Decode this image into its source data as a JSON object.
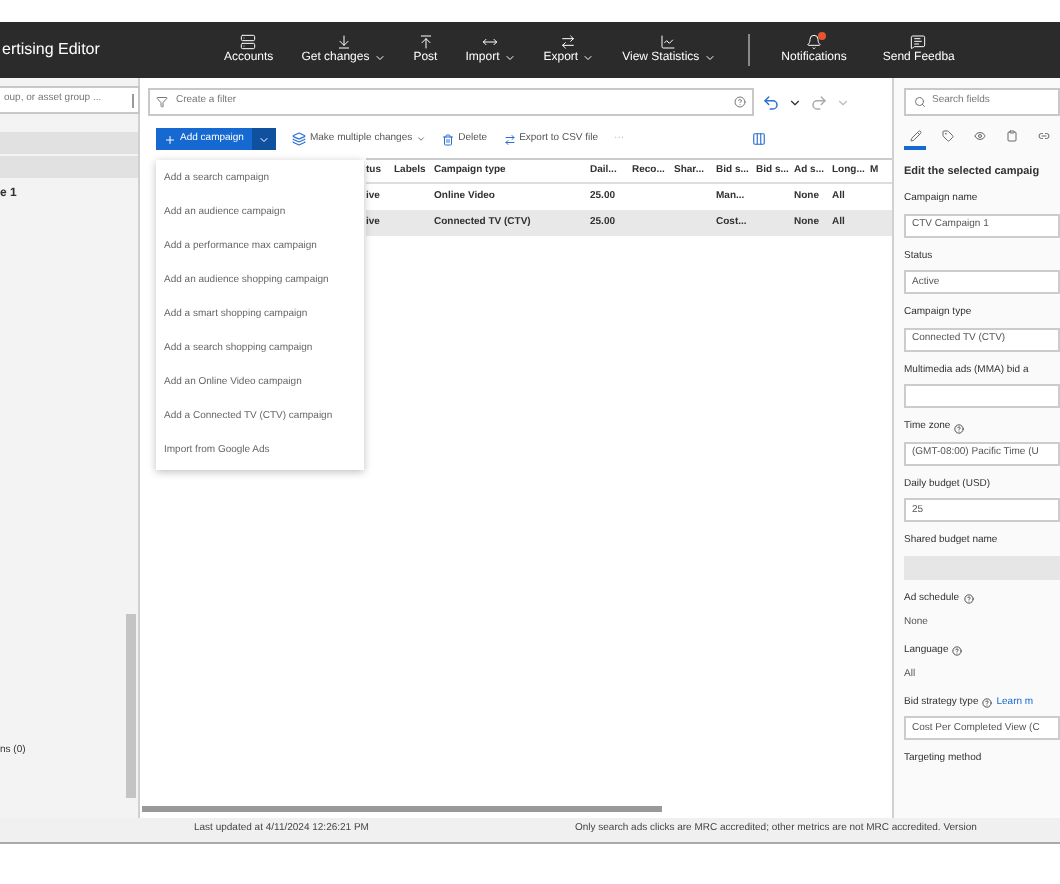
{
  "app_title": "ertising Editor",
  "toolbar": [
    {
      "label": "Accounts",
      "dropdown": false
    },
    {
      "label": "Get changes",
      "dropdown": true
    },
    {
      "label": "Post",
      "dropdown": false
    },
    {
      "label": "Import",
      "dropdown": true
    },
    {
      "label": "Export",
      "dropdown": true
    },
    {
      "label": "View Statistics",
      "dropdown": true
    }
  ],
  "toolbar_right": [
    {
      "label": "Notifications",
      "alert": true
    },
    {
      "label": "Send Feedba",
      "alert": false
    }
  ],
  "sidebar": {
    "search_placeholder": "oup, or asset group ...",
    "items": [
      {
        "label": "e 1"
      }
    ],
    "footer_item": "ns (0)"
  },
  "filter": {
    "placeholder": "Create a filter"
  },
  "actions": {
    "add": "Add campaign",
    "multiple": "Make multiple changes",
    "delete": "Delete",
    "export": "Export to CSV file",
    "more": "···"
  },
  "dropdown_menu": [
    "Add a search campaign",
    "Add an audience campaign",
    "Add a performance max campaign",
    "Add an audience shopping campaign",
    "Add a smart shopping campaign",
    "Add a search shopping campaign",
    "Add an Online Video campaign",
    "Add a Connected TV (CTV) campaign",
    "Import from Google Ads"
  ],
  "table": {
    "columns": [
      "tus",
      "Labels",
      "Campaign type",
      "Dail...",
      "Reco...",
      "Shar...",
      "Bid s...",
      "Bid s...",
      "Ad s...",
      "Long...",
      "M"
    ],
    "rows": [
      {
        "selected": false,
        "cells": [
          "ive",
          null,
          "Online Video",
          "25.00",
          null,
          null,
          "Man...",
          null,
          "None",
          "All",
          null
        ]
      },
      {
        "selected": true,
        "cells": [
          "ive",
          null,
          "Connected TV (CTV)",
          "25.00",
          null,
          null,
          "Cost...",
          null,
          "None",
          "All",
          null
        ]
      }
    ]
  },
  "editor": {
    "search_placeholder": "Search fields",
    "tabs": [
      {
        "selected": true
      },
      {
        "selected": false
      },
      {
        "selected": false
      },
      {
        "selected": false
      },
      {
        "selected": false
      }
    ],
    "heading": "Edit the selected campaig",
    "fields": [
      {
        "label": "Campaign name",
        "kind": "input",
        "value": "CTV Campaign 1",
        "help": false
      },
      {
        "label": "Status",
        "kind": "input",
        "value": "Active",
        "help": false
      },
      {
        "label": "Campaign type",
        "kind": "input",
        "value": "Connected TV (CTV)",
        "help": false
      },
      {
        "label": "Multimedia ads (MMA) bid a",
        "kind": "input",
        "help": false
      },
      {
        "label": "Time zone",
        "kind": "input",
        "value": "(GMT-08:00) Pacific Time (U",
        "help": true
      },
      {
        "label": "Daily budget (USD)",
        "kind": "input",
        "value": "25",
        "help": false
      },
      {
        "label": "Shared budget name",
        "kind": "disabled",
        "help": false
      },
      {
        "label": "Ad schedule",
        "kind": "text",
        "value": "None",
        "help": true
      },
      {
        "label": "Language",
        "kind": "text",
        "value": "All",
        "help": true
      },
      {
        "label": "Bid strategy type",
        "kind": "input",
        "value": "Cost Per Completed View (C",
        "help": true,
        "link": "Learn m"
      },
      {
        "label": "Targeting method",
        "kind": "label",
        "help": false
      }
    ]
  },
  "status_bar": {
    "left": "Last updated at 4/11/2024 12:26:21 PM",
    "right": "Only search ads clicks are MRC accredited; other metrics are not MRC accredited.  Version"
  }
}
